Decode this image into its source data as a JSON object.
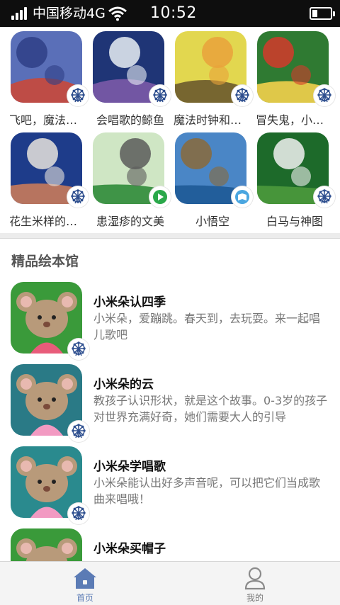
{
  "status_bar": {
    "carrier": "中国移动4G",
    "time": "10:52",
    "battery_level": 0.28
  },
  "grid": {
    "books": [
      {
        "title": "飞吧，魔法飞毯",
        "badge": "ferris-wheel-icon",
        "cover_colors": [
          "#5a6fb8",
          "#2f3f86",
          "#c9483a"
        ]
      },
      {
        "title": "会唱歌的鲸鱼",
        "badge": "ferris-wheel-icon",
        "cover_colors": [
          "#1f3576",
          "#e9eef5",
          "#7b5aa8"
        ]
      },
      {
        "title": "魔法时钟和小精灵",
        "badge": "ferris-wheel-icon",
        "cover_colors": [
          "#e2d74f",
          "#e9a23b",
          "#6b5a2c"
        ]
      },
      {
        "title": "冒失鬼，小精灵",
        "badge": "ferris-wheel-icon",
        "cover_colors": [
          "#2f7a32",
          "#d43a2b",
          "#f3d04b"
        ]
      },
      {
        "title": "花生米样的小宝宝",
        "badge": "ferris-wheel-icon",
        "cover_colors": [
          "#1e3c8a",
          "#e8e3dc",
          "#c87a5a"
        ]
      },
      {
        "title": "患湿疹的文美",
        "badge": "play-icon",
        "cover_colors": [
          "#cfe6c4",
          "#5b5b5b",
          "#2f8b3a"
        ]
      },
      {
        "title": "小悟空",
        "badge": "book-icon",
        "cover_colors": [
          "#4a86c6",
          "#8a6a3a",
          "#1e5a96"
        ]
      },
      {
        "title": "白马与神图",
        "badge": "ferris-wheel-icon",
        "cover_colors": [
          "#1d6a2a",
          "#f1f1f1",
          "#4c9a3c"
        ]
      }
    ]
  },
  "section": {
    "title": "精品绘本馆"
  },
  "list": {
    "items": [
      {
        "title": "小米朵认四季",
        "desc": "小米朵，爱蹦跳。春天到，去玩耍。来一起唱儿歌吧",
        "thumb_bg": "#3a9a3a",
        "dress": "#e85c7a"
      },
      {
        "title": "小米朵的云",
        "desc": "教孩子认识形状，就是这个故事。0-3岁的孩子对世界充满好奇，她们需要大人的引导",
        "thumb_bg": "#2a7a86",
        "dress": "#f29ac2"
      },
      {
        "title": "小米朵学唱歌",
        "desc": "小米朵能认出好多声音呢，可以把它们当成歌曲来唱哦！",
        "thumb_bg": "#2a8a8e",
        "dress": "#f29ac2"
      },
      {
        "title": "小米朵买帽子",
        "desc": "",
        "thumb_bg": "#3a9a3a",
        "dress": "#f29ac2"
      }
    ]
  },
  "bottom_nav": {
    "home_label": "首页",
    "mine_label": "我的",
    "active_color": "#5b7bb5"
  }
}
